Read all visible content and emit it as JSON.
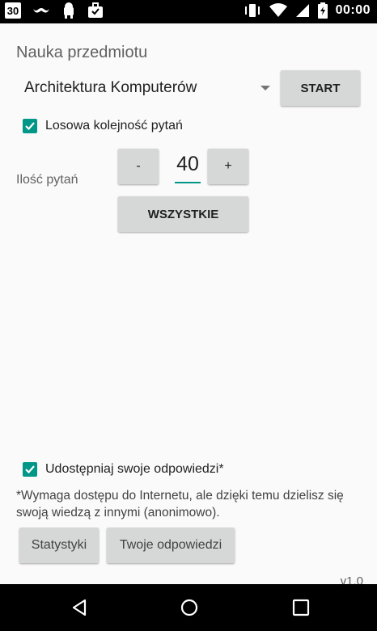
{
  "status_bar": {
    "notification_badge": "30",
    "clock": "00:00",
    "icons": [
      "calendar-badge-icon",
      "moustache-icon",
      "android-icon",
      "download-briefcase-icon",
      "vibrate-icon",
      "wifi-icon",
      "signal-icon",
      "battery-icon"
    ]
  },
  "header": {
    "title": "Nauka przedmiotu"
  },
  "subject": {
    "selected": "Architektura Komputerów"
  },
  "buttons": {
    "start": "START",
    "minus": "-",
    "plus": "+",
    "all": "WSZYSTKIE",
    "stats": "Statystyki",
    "my_answers": "Twoje odpowiedzi"
  },
  "random_order": {
    "label": "Losowa kolejność pytań",
    "checked": true
  },
  "questions": {
    "label": "Ilość pytań",
    "count": "40"
  },
  "share": {
    "label": "Udostępniaj swoje odpowiedzi*",
    "checked": true,
    "note": "*Wymaga dostępu do Internetu, ale dzięki temu dzielisz się swoją wiedzą z innymi (anonimowo)."
  },
  "version": "v1.0",
  "colors": {
    "accent": "#009688",
    "button": "#d6d7d7",
    "background": "#fafafa"
  }
}
